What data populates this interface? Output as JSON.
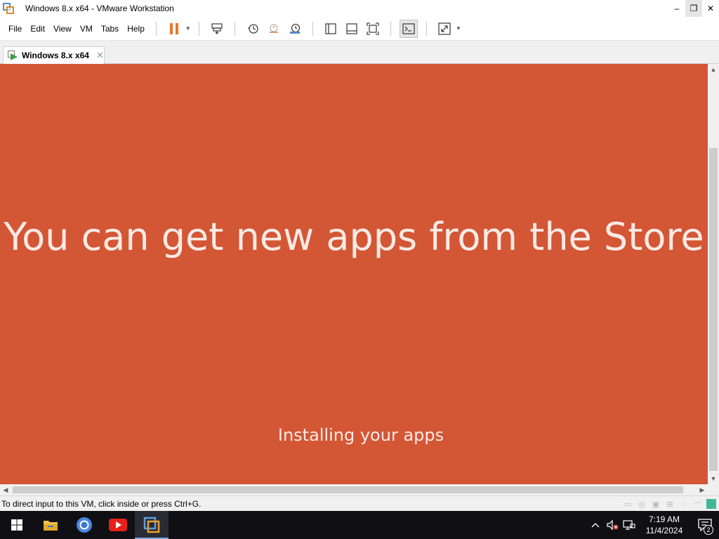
{
  "window": {
    "title": "Windows 8.x x64 - VMware Workstation",
    "minimize_glyph": "–",
    "restore_glyph": "❐",
    "close_glyph": "✕"
  },
  "menu": {
    "file": "File",
    "edit": "Edit",
    "view": "View",
    "vm": "VM",
    "tabs": "Tabs",
    "help": "Help"
  },
  "toolbar": {
    "icons": [
      "pause-icon",
      "send-ctrl-alt-del-icon",
      "snapshot-icon",
      "revert-snapshot-icon",
      "snapshot-manager-icon",
      "library-icon",
      "thumbnail-bar-icon",
      "full-screen-icon",
      "console-view-icon",
      "stretch-guest-icon"
    ],
    "accent": "#e8762d"
  },
  "tab": {
    "label": "Windows 8.x x64",
    "close_glyph": "✕"
  },
  "vm_screen": {
    "headline": "You can get new apps from the Store",
    "subtext": "Installing your apps",
    "background": "#d35635"
  },
  "statusbar": {
    "message": "To direct input to this VM, click inside or press Ctrl+G."
  },
  "taskbar": {
    "apps": [
      "windows-start-icon",
      "file-explorer-icon",
      "chrome-icon",
      "youtube-icon",
      "vmware-workstation-icon"
    ],
    "time": "7:19 AM",
    "date": "11/4/2024",
    "notification_count": "2"
  }
}
